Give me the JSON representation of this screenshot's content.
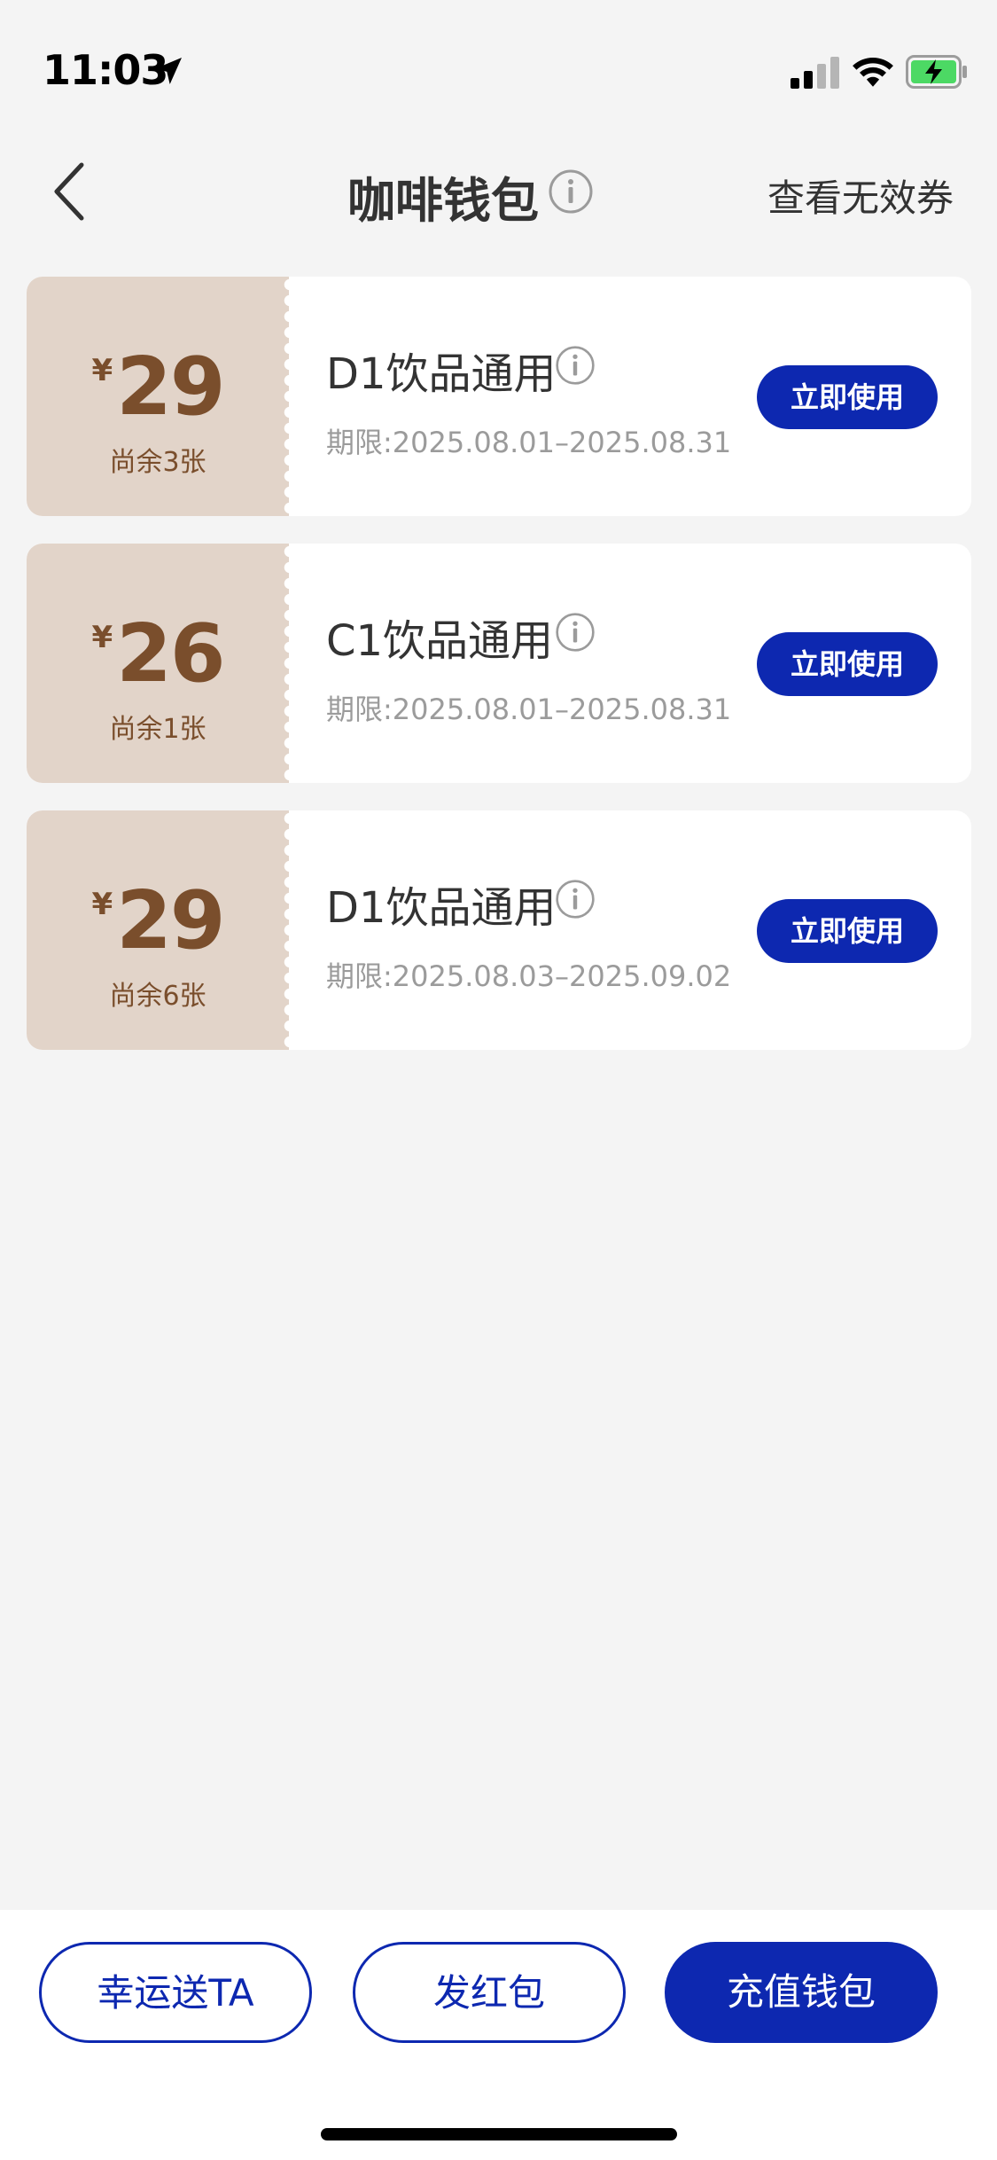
{
  "status_bar": {
    "time": "11:03",
    "icons": [
      "location-arrow-icon",
      "cellular-signal-icon",
      "wifi-icon",
      "battery-charging-icon"
    ]
  },
  "nav": {
    "title": "咖啡钱包",
    "right_link": "查看无效券",
    "icons": [
      "back-chevron-icon",
      "info-icon"
    ]
  },
  "coupons": [
    {
      "currency": "¥",
      "amount": "29",
      "remaining": "尚余3张",
      "name": "D1饮品通用",
      "validity": "期限:2025.08.01–2025.08.31",
      "action": "立即使用"
    },
    {
      "currency": "¥",
      "amount": "26",
      "remaining": "尚余1张",
      "name": "C1饮品通用",
      "validity": "期限:2025.08.01–2025.08.31",
      "action": "立即使用"
    },
    {
      "currency": "¥",
      "amount": "29",
      "remaining": "尚余6张",
      "name": "D1饮品通用",
      "validity": "期限:2025.08.03–2025.09.02",
      "action": "立即使用"
    }
  ],
  "bottom": {
    "lucky_gift": "幸运送TA",
    "red_packet": "发红包",
    "recharge": "充值钱包"
  },
  "colors": {
    "accent": "#0d28b0",
    "coupon_stub": "#e2d4c9",
    "price_text": "#7a4e2c",
    "background": "#f4f4f4"
  }
}
